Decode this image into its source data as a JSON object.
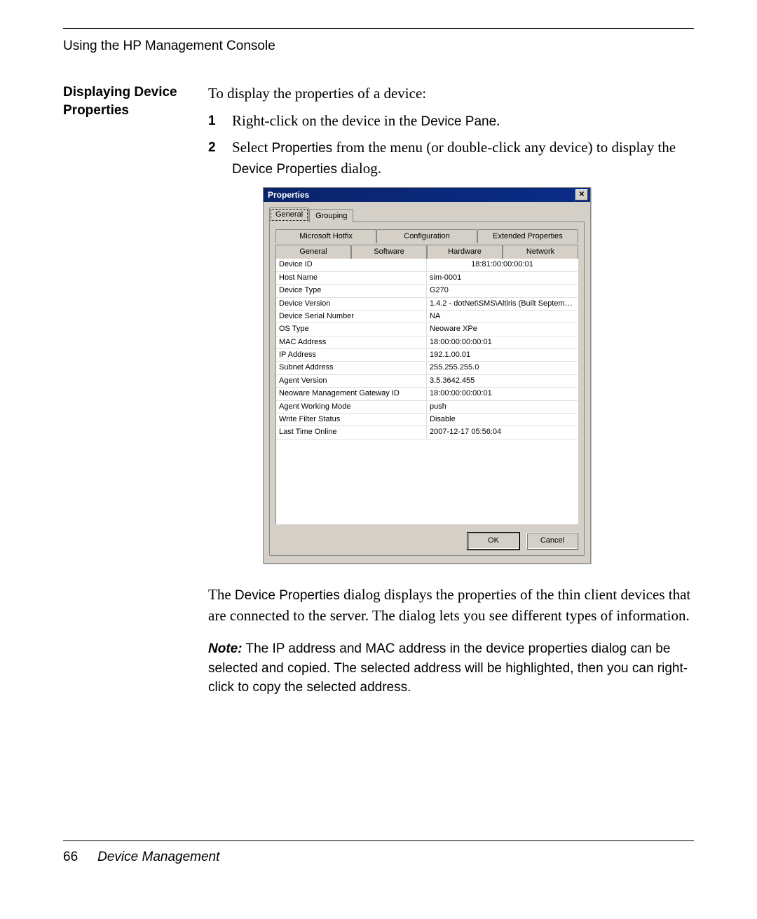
{
  "header": {
    "running": "Using the HP Management Console"
  },
  "side_heading": "Displaying Device Properties",
  "intro": "To display the properties of a device:",
  "steps": [
    {
      "num": "1",
      "pre": "Right-click on the device in the ",
      "ui": "Device Pane",
      "post": "."
    },
    {
      "num": "2",
      "pre": "Select ",
      "ui": "Properties",
      "mid": " from the menu (or double-click any device) to display the ",
      "ui2": "Device Properties",
      "post": " dialog."
    }
  ],
  "dialog": {
    "title": "Properties",
    "outer_tabs": [
      "General",
      "Grouping"
    ],
    "inner_tabs_row1": [
      "Microsoft Hotfix",
      "Configuration",
      "Extended Properties"
    ],
    "inner_tabs_row2": [
      "General",
      "Software",
      "Hardware",
      "Network"
    ],
    "inner_active": "General",
    "props": [
      {
        "k": "Device ID",
        "v": "18:81:00:00:00:01",
        "first": true
      },
      {
        "k": "Host Name",
        "v": "sim-0001"
      },
      {
        "k": "Device Type",
        "v": "G270"
      },
      {
        "k": "Device Version",
        "v": "1.4.2 - dotNet\\SMS\\Altiris (Built September ..."
      },
      {
        "k": "Device Serial Number",
        "v": "NA"
      },
      {
        "k": "OS Type",
        "v": "Neoware XPe"
      },
      {
        "k": "MAC Address",
        "v": "18:00:00:00:00:01"
      },
      {
        "k": "IP Address",
        "v": "192.1.00.01"
      },
      {
        "k": "Subnet Address",
        "v": "255.255.255.0"
      },
      {
        "k": "Agent Version",
        "v": "3.5.3642.455"
      },
      {
        "k": "Neoware Management Gateway ID",
        "v": "18:00:00:00:00:01"
      },
      {
        "k": "Agent Working Mode",
        "v": "push"
      },
      {
        "k": "Write Filter Status",
        "v": "Disable"
      },
      {
        "k": "Last Time Online",
        "v": "2007-12-17 05:56:04"
      }
    ],
    "buttons": {
      "ok": "OK",
      "cancel": "Cancel"
    }
  },
  "after": {
    "pre": "The ",
    "ui": "Device Properties",
    "post": " dialog displays the properties of the thin client devices that are connected to the server. The dialog lets you see different types of information."
  },
  "note": {
    "label": "Note:",
    "text": " The IP address and MAC address in the device properties dialog can be selected and copied. The selected address will be highlighted, then you can right-click to copy the selected address."
  },
  "footer": {
    "page": "66",
    "section": "Device Management"
  }
}
